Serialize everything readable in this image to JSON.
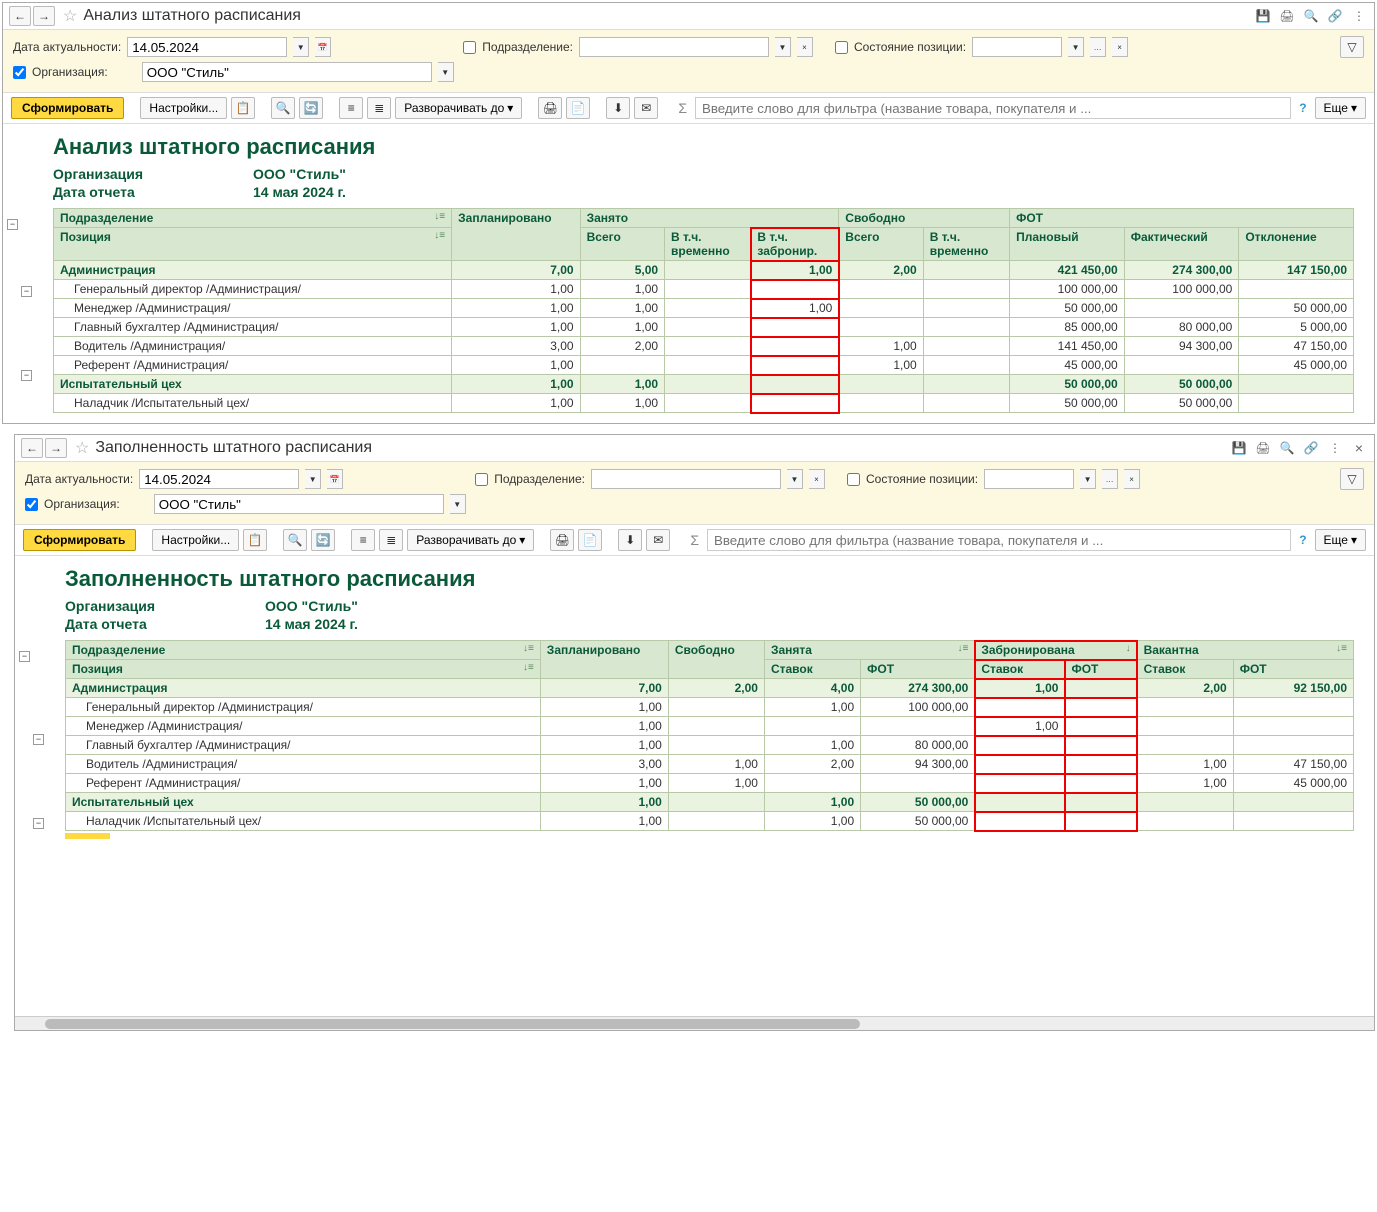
{
  "win1": {
    "title": "Анализ штатного расписания",
    "filters": {
      "date_label": "Дата актуальности:",
      "date_value": "14.05.2024",
      "org_label": "Организация:",
      "org_value": "ООО \"Стиль\"",
      "dept_label": "Подразделение:",
      "status_label": "Состояние позиции:"
    },
    "toolbar": {
      "generate": "Сформировать",
      "settings": "Настройки...",
      "expand": "Разворачивать до",
      "more": "Еще",
      "search_ph": "Введите слово для фильтра (название товара, покупателя и ..."
    },
    "report": {
      "title": "Анализ штатного расписания",
      "org_label": "Организация",
      "org_value": "ООО \"Стиль\"",
      "date_label": "Дата отчета",
      "date_value": "14 мая 2024 г.",
      "headers": {
        "c1a": "Подразделение",
        "c1b": "Позиция",
        "c2": "Запланировано",
        "c3": "Занято",
        "c3a": "Всего",
        "c3b": "В т.ч. временно",
        "c3c": "В т.ч. забронир.",
        "c4": "Свободно",
        "c4a": "Всего",
        "c4b": "В т.ч. временно",
        "c5": "ФОТ",
        "c5a": "Плановый",
        "c5b": "Фактический",
        "c5c": "Отклонение"
      },
      "groups": [
        {
          "name": "Администрация",
          "plan": "7,00",
          "busy_total": "5,00",
          "busy_temp": "",
          "busy_res": "1,00",
          "free_total": "2,00",
          "free_temp": "",
          "fot_plan": "421 450,00",
          "fot_fact": "274 300,00",
          "fot_dev": "147 150,00",
          "rows": [
            {
              "name": "Генеральный директор /Администрация/",
              "plan": "1,00",
              "busy_total": "1,00",
              "busy_temp": "",
              "busy_res": "",
              "free_total": "",
              "free_temp": "",
              "fot_plan": "100 000,00",
              "fot_fact": "100 000,00",
              "fot_dev": ""
            },
            {
              "name": "Менеджер /Администрация/",
              "plan": "1,00",
              "busy_total": "1,00",
              "busy_temp": "",
              "busy_res": "1,00",
              "free_total": "",
              "free_temp": "",
              "fot_plan": "50 000,00",
              "fot_fact": "",
              "fot_dev": "50 000,00"
            },
            {
              "name": "Главный бухгалтер /Администрация/",
              "plan": "1,00",
              "busy_total": "1,00",
              "busy_temp": "",
              "busy_res": "",
              "free_total": "",
              "free_temp": "",
              "fot_plan": "85 000,00",
              "fot_fact": "80 000,00",
              "fot_dev": "5 000,00"
            },
            {
              "name": "Водитель /Администрация/",
              "plan": "3,00",
              "busy_total": "2,00",
              "busy_temp": "",
              "busy_res": "",
              "free_total": "1,00",
              "free_temp": "",
              "fot_plan": "141 450,00",
              "fot_fact": "94 300,00",
              "fot_dev": "47 150,00"
            },
            {
              "name": "Референт /Администрация/",
              "plan": "1,00",
              "busy_total": "",
              "busy_temp": "",
              "busy_res": "",
              "free_total": "1,00",
              "free_temp": "",
              "fot_plan": "45 000,00",
              "fot_fact": "",
              "fot_dev": "45 000,00"
            }
          ]
        },
        {
          "name": "Испытательный цех",
          "plan": "1,00",
          "busy_total": "1,00",
          "busy_temp": "",
          "busy_res": "",
          "free_total": "",
          "free_temp": "",
          "fot_plan": "50 000,00",
          "fot_fact": "50 000,00",
          "fot_dev": "",
          "rows": [
            {
              "name": "Наладчик /Испытательный цех/",
              "plan": "1,00",
              "busy_total": "1,00",
              "busy_temp": "",
              "busy_res": "",
              "free_total": "",
              "free_temp": "",
              "fot_plan": "50 000,00",
              "fot_fact": "50 000,00",
              "fot_dev": ""
            }
          ]
        }
      ]
    }
  },
  "win2": {
    "title": "Заполненность штатного расписания",
    "filters": {
      "date_label": "Дата актуальности:",
      "date_value": "14.05.2024",
      "org_label": "Организация:",
      "org_value": "ООО \"Стиль\"",
      "dept_label": "Подразделение:",
      "status_label": "Состояние позиции:"
    },
    "toolbar": {
      "generate": "Сформировать",
      "settings": "Настройки...",
      "expand": "Разворачивать до",
      "more": "Еще",
      "search_ph": "Введите слово для фильтра (название товара, покупателя и ..."
    },
    "report": {
      "title": "Заполненность штатного расписания",
      "org_label": "Организация",
      "org_value": "ООО \"Стиль\"",
      "date_label": "Дата отчета",
      "date_value": "14 мая 2024 г.",
      "headers": {
        "c1a": "Подразделение",
        "c1b": "Позиция",
        "c2": "Запланировано",
        "c3": "Свободно",
        "c4": "Занята",
        "c4a": "Ставок",
        "c4b": "ФОТ",
        "c5": "Забронирована",
        "c5a": "Ставок",
        "c5b": "ФОТ",
        "c6": "Вакантна",
        "c6a": "Ставок",
        "c6b": "ФОТ"
      },
      "groups": [
        {
          "name": "Администрация",
          "plan": "7,00",
          "free": "2,00",
          "occ_st": "4,00",
          "occ_fot": "274 300,00",
          "res_st": "1,00",
          "res_fot": "",
          "vac_st": "2,00",
          "vac_fot": "92 150,00",
          "rows": [
            {
              "name": "Генеральный директор /Администрация/",
              "plan": "1,00",
              "free": "",
              "occ_st": "1,00",
              "occ_fot": "100 000,00",
              "res_st": "",
              "res_fot": "",
              "vac_st": "",
              "vac_fot": ""
            },
            {
              "name": "Менеджер /Администрация/",
              "plan": "1,00",
              "free": "",
              "occ_st": "",
              "occ_fot": "",
              "res_st": "1,00",
              "res_fot": "",
              "vac_st": "",
              "vac_fot": ""
            },
            {
              "name": "Главный бухгалтер /Администрация/",
              "plan": "1,00",
              "free": "",
              "occ_st": "1,00",
              "occ_fot": "80 000,00",
              "res_st": "",
              "res_fot": "",
              "vac_st": "",
              "vac_fot": ""
            },
            {
              "name": "Водитель /Администрация/",
              "plan": "3,00",
              "free": "1,00",
              "occ_st": "2,00",
              "occ_fot": "94 300,00",
              "res_st": "",
              "res_fot": "",
              "vac_st": "1,00",
              "vac_fot": "47 150,00"
            },
            {
              "name": "Референт /Администрация/",
              "plan": "1,00",
              "free": "1,00",
              "occ_st": "",
              "occ_fot": "",
              "res_st": "",
              "res_fot": "",
              "vac_st": "1,00",
              "vac_fot": "45 000,00"
            }
          ]
        },
        {
          "name": "Испытательный цех",
          "plan": "1,00",
          "free": "",
          "occ_st": "1,00",
          "occ_fot": "50 000,00",
          "res_st": "",
          "res_fot": "",
          "vac_st": "",
          "vac_fot": "",
          "rows": [
            {
              "name": "Наладчик /Испытательный цех/",
              "plan": "1,00",
              "free": "",
              "occ_st": "1,00",
              "occ_fot": "50 000,00",
              "res_st": "",
              "res_fot": "",
              "vac_st": "",
              "vac_fot": ""
            }
          ]
        }
      ]
    }
  }
}
